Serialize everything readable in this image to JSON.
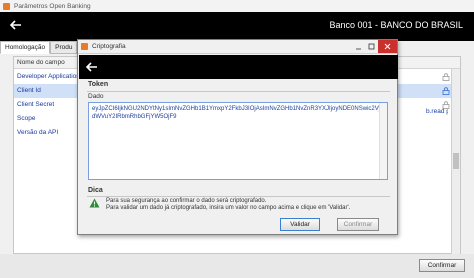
{
  "outer_window": {
    "title": "Parâmetros Open Banking",
    "bank_title": "Banco 001 - BANCO DO BRASIL",
    "tabs": [
      "Homologação",
      "Produ"
    ],
    "grid_header": "Nome do campo",
    "rows": [
      "Developer Application",
      "Client Id",
      "Client Secret",
      "Scope",
      "Versão da API"
    ],
    "right_value": "b.read pix.re",
    "confirm_label": "Confirmar"
  },
  "modal": {
    "title": "Criptografia",
    "token_label": "Token",
    "dado_label": "Dado",
    "token_value": "eyJpZCI6IjkNGU2NDYtNy1sImNvZGHb1B1YmxpY2FkbJ3IOjAsImNvZGHb1NvZnR3YXJIjoyNDE0NSwic2VydWVuY2IRbmRhbGFjYW5OjF9",
    "dica_label": "Dica",
    "hint_1": "Para sua segurança ao confirmar o dado será criptografado.",
    "hint_2": "Para validar um dado já criptografado, insira um valor no campo acima e clique em 'Validar'.",
    "validar_label": "Validar",
    "confirmar_label": "Confirmar"
  },
  "icons": {
    "app": "app-icon",
    "back": "back-arrow-icon",
    "lock": "lock-icon",
    "warning": "warning-icon",
    "minimize": "minimize-icon",
    "maximize": "maximize-icon",
    "close": "close-icon"
  },
  "colors": {
    "header_bg": "#000000",
    "link_text": "#1a3aa0",
    "close_button": "#c9302c",
    "warning_green": "#2e8b3a"
  }
}
